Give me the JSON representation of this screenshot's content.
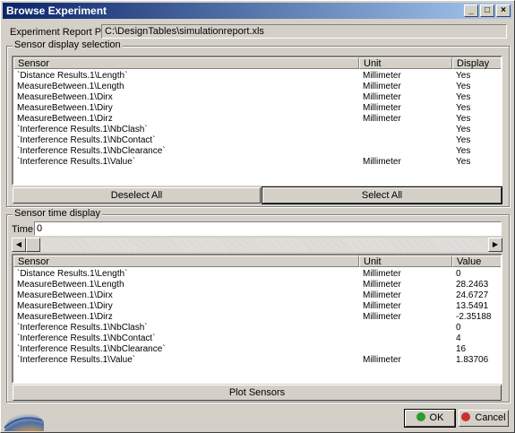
{
  "window": {
    "title": "Browse Experiment",
    "buttons": [
      "_",
      "□",
      "×"
    ]
  },
  "report": {
    "label": "Experiment Report Path:",
    "path": "C:\\DesignTables\\simulationreport.xls"
  },
  "sensor_selection": {
    "group_label": "Sensor display selection",
    "columns": [
      "Sensor",
      "Unit",
      "Display"
    ],
    "rows": [
      {
        "sensor": "`Distance Results.1\\Length`",
        "unit": "Millimeter",
        "display": "Yes"
      },
      {
        "sensor": "MeasureBetween.1\\Length",
        "unit": "Millimeter",
        "display": "Yes"
      },
      {
        "sensor": "MeasureBetween.1\\Dirx",
        "unit": "Millimeter",
        "display": "Yes"
      },
      {
        "sensor": "MeasureBetween.1\\Diry",
        "unit": "Millimeter",
        "display": "Yes"
      },
      {
        "sensor": "MeasureBetween.1\\Dirz",
        "unit": "Millimeter",
        "display": "Yes"
      },
      {
        "sensor": "`Interference Results.1\\NbClash`",
        "unit": "",
        "display": "Yes"
      },
      {
        "sensor": "`Interference Results.1\\NbContact`",
        "unit": "",
        "display": "Yes"
      },
      {
        "sensor": "`Interference Results.1\\NbClearance`",
        "unit": "",
        "display": "Yes"
      },
      {
        "sensor": "`Interference Results.1\\Value`",
        "unit": "Millimeter",
        "display": "Yes"
      }
    ],
    "deselect_label": "Deselect All",
    "select_label": "Select All"
  },
  "sensor_time": {
    "group_label": "Sensor time display",
    "time_label": "Time:",
    "time_value": "0",
    "columns": [
      "Sensor",
      "Unit",
      "Value"
    ],
    "rows": [
      {
        "sensor": "`Distance Results.1\\Length`",
        "unit": "Millimeter",
        "value": "0"
      },
      {
        "sensor": "MeasureBetween.1\\Length",
        "unit": "Millimeter",
        "value": "28.2463"
      },
      {
        "sensor": "MeasureBetween.1\\Dirx",
        "unit": "Millimeter",
        "value": "24.6727"
      },
      {
        "sensor": "MeasureBetween.1\\Diry",
        "unit": "Millimeter",
        "value": "13.5491"
      },
      {
        "sensor": "MeasureBetween.1\\Dirz",
        "unit": "Millimeter",
        "value": "-2.35188"
      },
      {
        "sensor": "`Interference Results.1\\NbClash`",
        "unit": "",
        "value": "0"
      },
      {
        "sensor": "`Interference Results.1\\NbContact`",
        "unit": "",
        "value": "4"
      },
      {
        "sensor": "`Interference Results.1\\NbClearance`",
        "unit": "",
        "value": "16"
      },
      {
        "sensor": "`Interference Results.1\\Value`",
        "unit": "Millimeter",
        "value": "1.83706"
      }
    ],
    "plot_label": "Plot Sensors"
  },
  "footer": {
    "ok_label": "OK",
    "cancel_label": "Cancel",
    "ok_icon": "green-dot-icon",
    "cancel_icon": "red-dot-icon"
  },
  "colors": {
    "title_start": "#0a246a",
    "title_end": "#a6caf0",
    "ok_icon": "#2a9d2a",
    "cancel_icon": "#c83030"
  }
}
